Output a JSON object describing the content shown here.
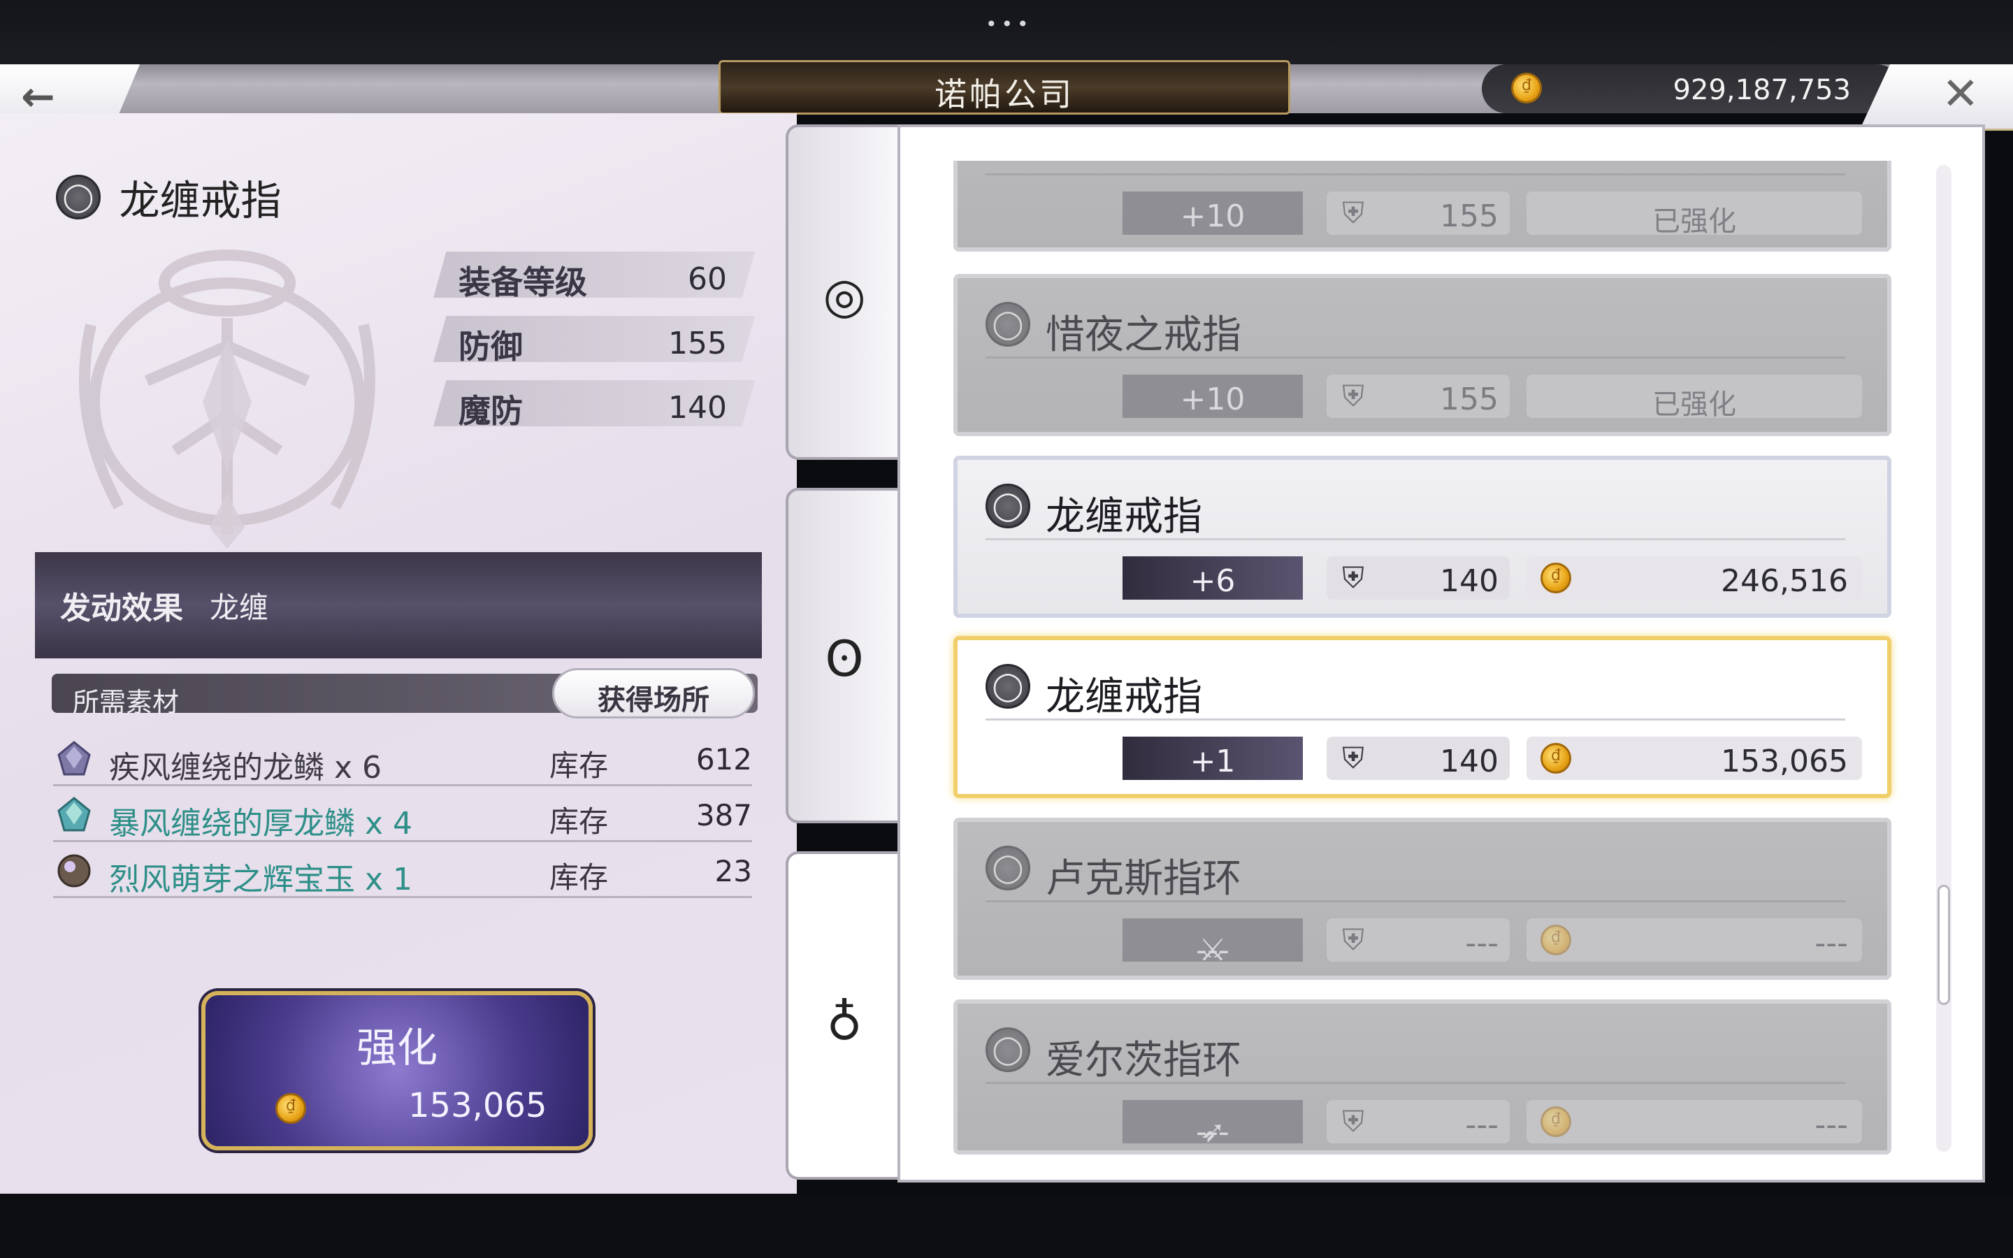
{
  "header": {
    "title": "诺帕公司",
    "currency": "929,187,753",
    "back_icon": "←",
    "close_icon": "✕",
    "menu_dots": "•••"
  },
  "item": {
    "name": "龙缠戒指",
    "stats": [
      {
        "label": "装备等级",
        "value": "60"
      },
      {
        "label": "防御",
        "value": "155"
      },
      {
        "label": "魔防",
        "value": "140"
      }
    ],
    "effect_label": "发动效果",
    "effect_value": "龙缠"
  },
  "materials": {
    "header": "所需素材",
    "source_button": "获得场所",
    "stock_label": "库存",
    "rows": [
      {
        "name": "疾风缠绕的龙鳞 x 6",
        "count": "612",
        "color": "#3e3a44"
      },
      {
        "name": "暴风缠绕的厚龙鳞 x 4",
        "count": "387",
        "color": "#2d8f88"
      },
      {
        "name": "烈风萌芽之辉宝玉 x 1",
        "count": "23",
        "color": "#2d8f88"
      }
    ]
  },
  "enhance": {
    "label": "强化",
    "cost": "153,065"
  },
  "tabs": [
    {
      "name": "armlet",
      "glyph": "◎"
    },
    {
      "name": "necklace",
      "glyph": "ʘ"
    },
    {
      "name": "ring",
      "glyph": "♁"
    }
  ],
  "list": [
    {
      "name": "",
      "level": "+10",
      "defense": "155",
      "cost": "",
      "status": "已强化",
      "state": "dim"
    },
    {
      "name": "惜夜之戒指",
      "level": "+10",
      "defense": "155",
      "cost": "",
      "status": "已强化",
      "state": "dim"
    },
    {
      "name": "龙缠戒指",
      "level": "+6",
      "defense": "140",
      "cost": "246,516",
      "status": "",
      "state": "normal"
    },
    {
      "name": "龙缠戒指",
      "level": "+1",
      "defense": "140",
      "cost": "153,065",
      "status": "",
      "state": "selected"
    },
    {
      "name": "卢克斯指环",
      "level": "---",
      "defense": "---",
      "cost": "---",
      "status": "",
      "state": "dim"
    },
    {
      "name": "爱尔茨指环",
      "level": "---",
      "defense": "---",
      "cost": "---",
      "status": "",
      "state": "dim"
    }
  ],
  "colors": {
    "accent_gold": "#f0cf6a",
    "purple_dark": "#3d3748",
    "teal_text": "#2d8f88"
  }
}
